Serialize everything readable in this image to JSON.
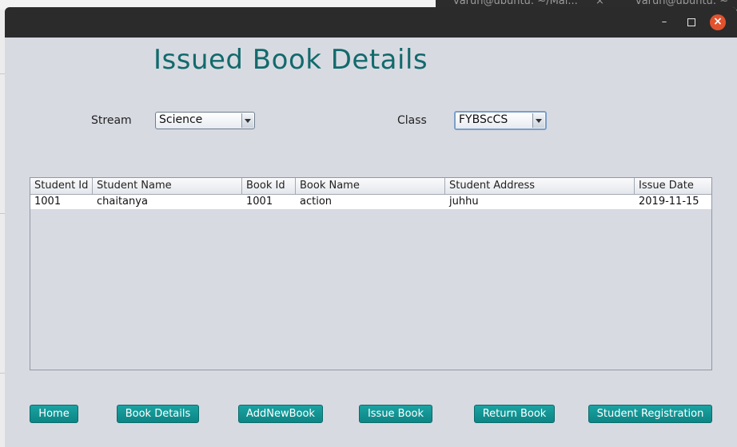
{
  "background": {
    "terminal_tabs": [
      "varun@ubuntu: ~/Mai...",
      "varun@ubuntu: ~"
    ]
  },
  "window": {
    "controls": {
      "minimize": "–",
      "close": "×"
    }
  },
  "main": {
    "title": "Issued Book Details",
    "stream_label": "Stream",
    "stream_value": "Science",
    "class_label": "Class",
    "class_value": "FYBScCS"
  },
  "table": {
    "columns": [
      "Student Id",
      "Student Name",
      "Book Id",
      "Book Name",
      "Student Address",
      "Issue Date"
    ],
    "rows": [
      [
        "1001",
        "chaitanya",
        "1001",
        "action",
        "juhhu",
        "2019-11-15"
      ]
    ]
  },
  "buttons": {
    "home": "Home",
    "book_details": "Book Details",
    "add_new_book": "AddNewBook",
    "issue_book": "Issue Book",
    "return_book": "Return Book",
    "student_registration": "Student Registration"
  },
  "colors": {
    "title": "#126a6c",
    "button": "#0e8585",
    "titlebar": "#2b2b2b",
    "window_bg": "#d8dae2",
    "close_button": "#e2522d"
  }
}
